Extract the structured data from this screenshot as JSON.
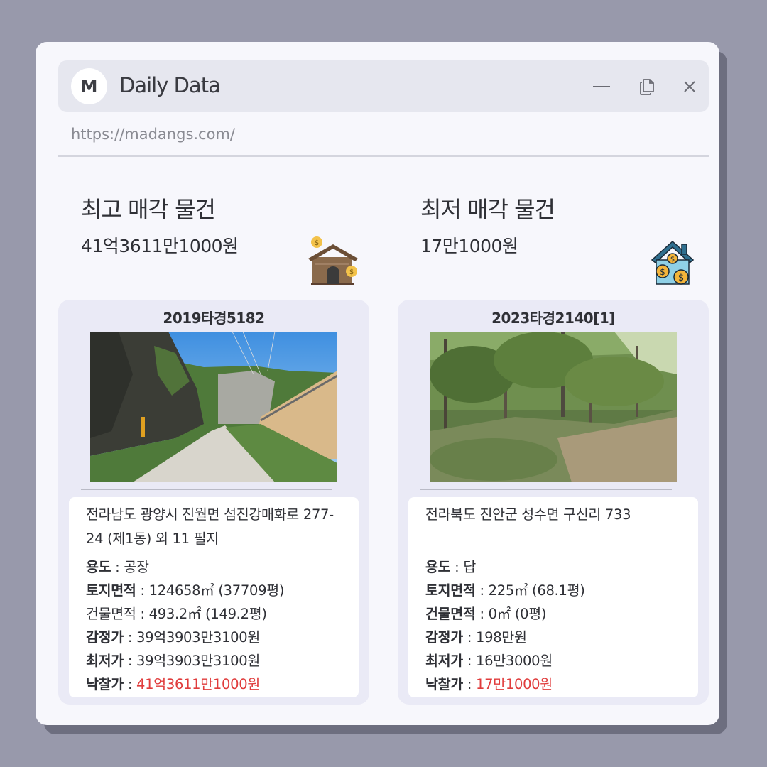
{
  "window": {
    "logo_letter": "M",
    "title": "Daily Data",
    "url": "https://madangs.com/"
  },
  "highest": {
    "heading": "최고 매각 물건",
    "price": "41억3611만1000원",
    "icon": "warehouse-money-icon",
    "card": {
      "case_no": "2019타경5182",
      "address": "전라남도 광양시 진월면 섬진강매화로 277-24 (제1동) 외 11 필지",
      "use_label": "용도",
      "use_value": " : 공장",
      "land_label": "토지면적",
      "land_value": " : 124658㎡ (37709평)",
      "building_label": "건물면적",
      "building_value": " : 493.2㎡ (149.2평)",
      "appraisal_label": "감정가",
      "appraisal_value": " : 39억3903만3100원",
      "minimum_label": "최저가",
      "minimum_value": " : 39억3903만3100원",
      "winning_label": "낙찰가",
      "winning_sep": " : ",
      "winning_value": "41억3611만1000원"
    }
  },
  "lowest": {
    "heading": "최저 매각 물건",
    "price": "17만1000원",
    "icon": "house-money-icon",
    "card": {
      "case_no": "2023타경2140[1]",
      "address": "전라북도 진안군 성수면 구신리 733",
      "use_label": "용도",
      "use_value": " : 답",
      "land_label": "토지면적",
      "land_value": " : 225㎡ (68.1평)",
      "building_label": "건물면적",
      "building_value": " : 0㎡ (0평)",
      "appraisal_label": "감정가",
      "appraisal_value": " : 198만원",
      "minimum_label": "최저가",
      "minimum_value": " : 16만3000원",
      "winning_label": "낙찰가",
      "winning_sep": " : ",
      "winning_value": "17만1000원"
    }
  },
  "colors": {
    "background": "#9899ab",
    "window": "#f7f7fc",
    "card": "#eaeaf6",
    "highlight": "#e03c3c"
  }
}
